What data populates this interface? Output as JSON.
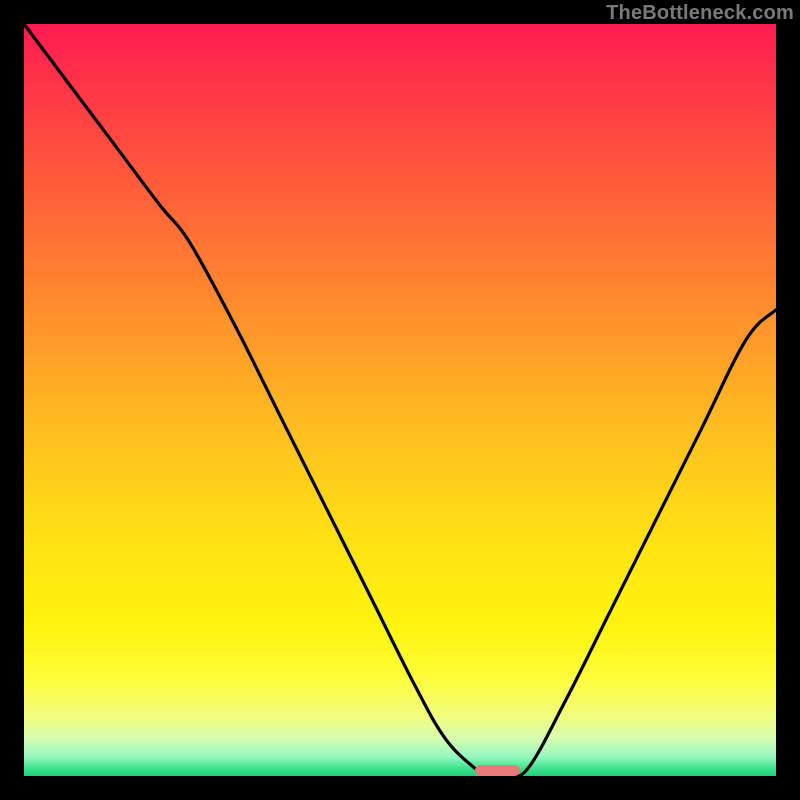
{
  "watermark": "TheBottleneck.com",
  "colors": {
    "frame": "#000000",
    "curve": "#000000",
    "marker": "#ea7a78",
    "gradient_top": "#ff1a52",
    "gradient_bottom": "#1fd07a"
  },
  "chart_data": {
    "type": "line",
    "title": "",
    "xlabel": "",
    "ylabel": "",
    "xlim": [
      0,
      100
    ],
    "ylim": [
      0,
      100
    ],
    "grid": false,
    "legend": false,
    "series": [
      {
        "name": "bottleneck-curve",
        "x": [
          0,
          6,
          12,
          18,
          22,
          28,
          34,
          40,
          46,
          52,
          56,
          60,
          62,
          64,
          67,
          72,
          78,
          84,
          90,
          96,
          100
        ],
        "y": [
          100,
          92,
          84,
          76,
          71,
          60,
          48,
          36,
          24,
          12,
          5,
          1,
          0,
          0,
          1,
          10,
          22,
          34,
          46,
          58,
          62
        ]
      }
    ],
    "annotations": [
      {
        "name": "optimum-marker",
        "x_start": 60,
        "x_end": 66,
        "y": 0
      }
    ]
  }
}
